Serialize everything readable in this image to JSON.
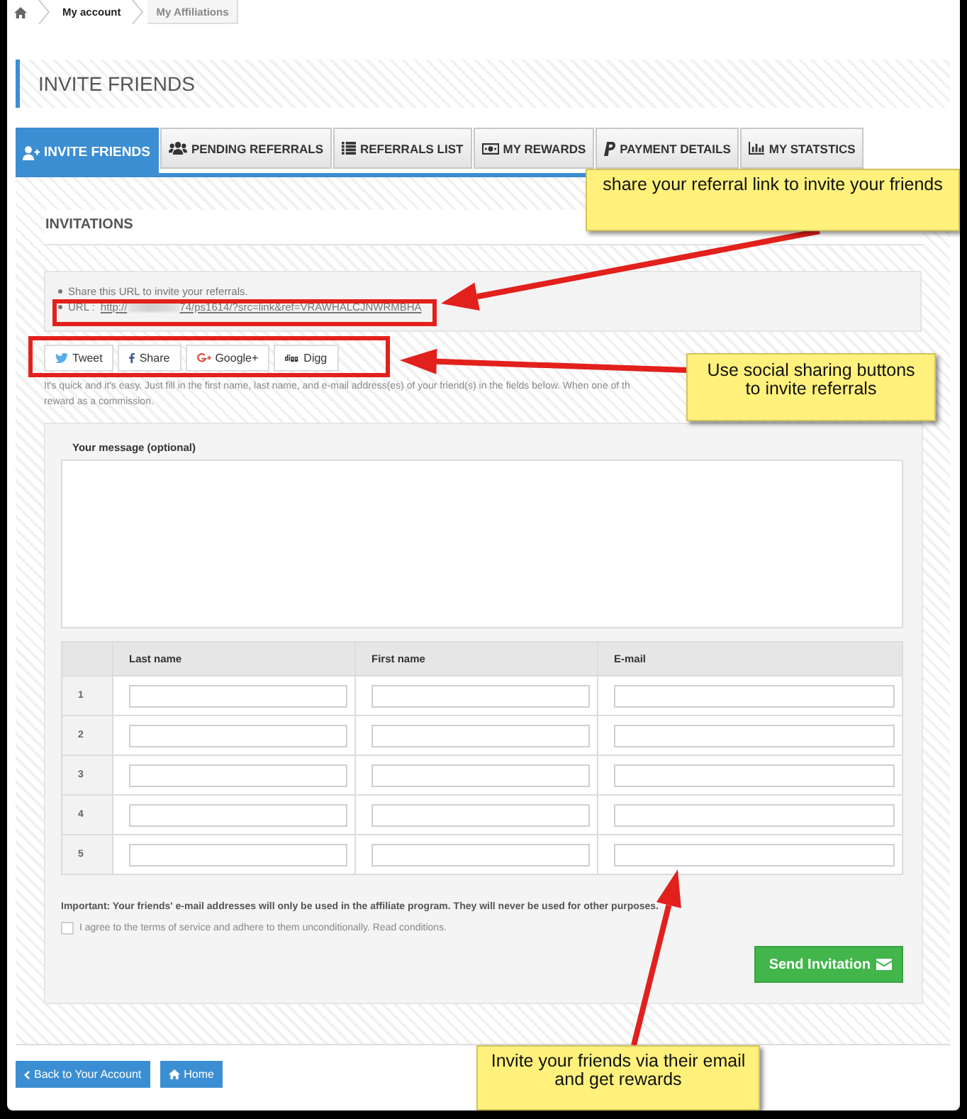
{
  "breadcrumb": [
    {
      "label": "My account",
      "kind": "link"
    },
    {
      "label": "My Affiliations",
      "kind": "current"
    }
  ],
  "page_title": "INVITE FRIENDS",
  "tabs": [
    {
      "label": "INVITE FRIENDS",
      "selected": true
    },
    {
      "label": "PENDING REFERRALS",
      "selected": false
    },
    {
      "label": "REFERRALS LIST",
      "selected": false
    },
    {
      "label": "MY REWARDS",
      "selected": false
    },
    {
      "label": "PAYMENT DETAILS",
      "selected": false
    },
    {
      "label": "MY STATSTICS",
      "selected": false
    }
  ],
  "invitations": {
    "title": "INVITATIONS",
    "share_note": "Share this URL to invite your referrals.",
    "url_label": "URL :",
    "url_start": "http://",
    "url_end": "74/ps1614/?src=link&ref=VRAWHALCJNWRMBHA",
    "social_buttons": [
      "Tweet",
      "Share",
      "Google+",
      "Digg"
    ],
    "intro_lines": [
      "It's quick and it's easy. Just fill in the first name, last name, and e-mail address(es) of your friend(s) in the fields below. When one of th",
      "reward as a commission."
    ],
    "message_label": "Your message (optional)",
    "table": {
      "columns": [
        "Last name",
        "First name",
        "E-mail"
      ],
      "row_numbers": [
        "1",
        "2",
        "3",
        "4",
        "5"
      ]
    },
    "notice": "Important: Your friends' e-mail addresses will only be used in the affiliate program. They will never be used for other purposes.",
    "terms": {
      "label": "I agree to the terms of service and adhere to them unconditionally. Read conditions.",
      "checked": false
    },
    "send_button": "Send Invitation"
  },
  "footer_buttons": [
    "Back to Your Account",
    "Home"
  ],
  "annotations": [
    {
      "text": "share your referral link to invite your friends"
    },
    {
      "text": "Use social sharing buttons to invite referrals"
    },
    {
      "text": "Invite your friends via their email and get rewards"
    }
  ]
}
